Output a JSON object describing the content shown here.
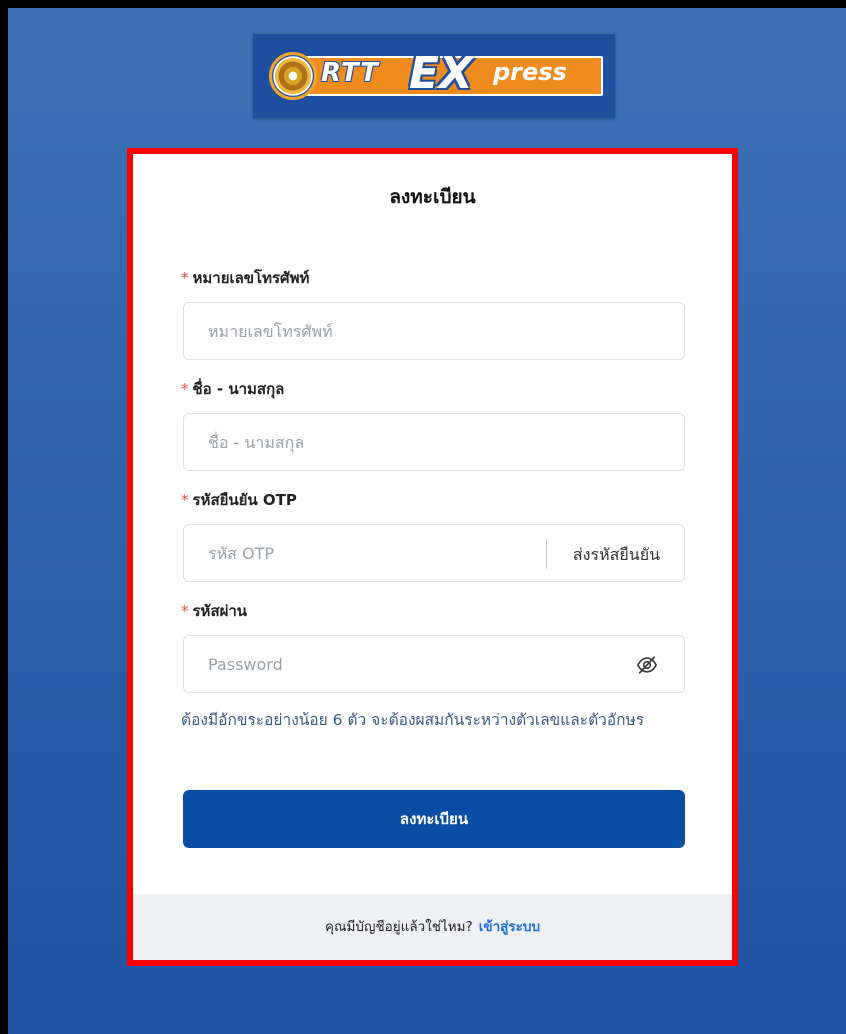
{
  "logo": {
    "brand_prefix": "RTT",
    "brand_ex": "EX",
    "brand_suffix": "press"
  },
  "form": {
    "title": "ลงทะเบียน",
    "phone": {
      "label": "หมายเลขโทรศัพท์",
      "placeholder": "หมายเลขโทรศัพท์",
      "required_mark": "*"
    },
    "fullname": {
      "label": "ชื่อ - นามสกุล",
      "placeholder": "ชื่อ - นามสกุล",
      "required_mark": "*"
    },
    "otp": {
      "label": "รหัสยืนยัน OTP",
      "placeholder": "รหัส OTP",
      "send_label": "ส่งรหัสยืนยัน",
      "required_mark": "*"
    },
    "password": {
      "label": "รหัสผ่าน",
      "placeholder": "Password",
      "required_mark": "*",
      "toggle_icon": "eye-slash-icon"
    },
    "hint": "ต้องมีอักขระอย่างน้อย 6 ตัว จะต้องผสมกันระหว่างตัวเลขและตัวอักษร",
    "submit_label": "ลงทะเบียน"
  },
  "footer": {
    "question": "คุณมีบัญชีอยู่แล้วใช่ไหม?",
    "login_link": "เข้าสู่ระบบ"
  },
  "colors": {
    "background_top": "#3d72b4",
    "background_bottom": "#1f55a3",
    "highlight_border": "#ff0000",
    "primary_button": "#0a4ea3",
    "required_mark": "#e5484d",
    "link": "#1f6fe0",
    "hint_text": "#3a5a86"
  }
}
